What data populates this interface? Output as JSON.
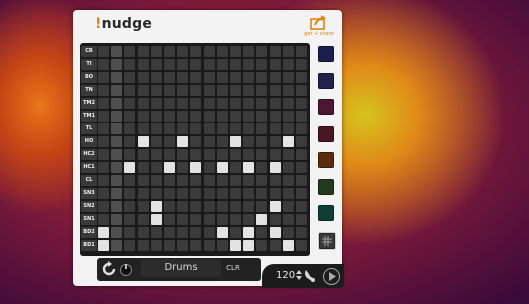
{
  "app": {
    "logo_mark": "!",
    "logo_text": "nudge",
    "share_label": "get + share"
  },
  "tracks": [
    "CR",
    "TI",
    "BO",
    "TN",
    "TM2",
    "TM1",
    "TL",
    "HO",
    "HC2",
    "HC1",
    "CL",
    "SN3",
    "SN2",
    "SN1",
    "BD2",
    "BD1"
  ],
  "steps": 16,
  "pattern": [
    [],
    [],
    [],
    [],
    [],
    [],
    [],
    [
      3,
      6,
      10,
      14
    ],
    [],
    [
      2,
      5,
      7,
      9,
      11,
      13
    ],
    [],
    [],
    [
      4,
      13
    ],
    [
      4,
      12
    ],
    [
      0,
      9,
      11,
      13
    ],
    [
      0,
      10,
      11,
      14
    ]
  ],
  "highlight_step": 1,
  "swatches": [
    {
      "name": "swatch-blue",
      "color": "#1a1f4d"
    },
    {
      "name": "swatch-indigo",
      "color": "#23204a"
    },
    {
      "name": "swatch-plum",
      "color": "#4a1734"
    },
    {
      "name": "swatch-maroon",
      "color": "#4a1524"
    },
    {
      "name": "swatch-brown",
      "color": "#5a2d0e"
    },
    {
      "name": "swatch-olive",
      "color": "#233a1e"
    },
    {
      "name": "swatch-teal",
      "color": "#103e36"
    }
  ],
  "toolbar": {
    "kit_name": "Drums",
    "clr_label": "CLR"
  },
  "transport": {
    "tempo": "120"
  },
  "colors": {
    "accent": "#e08412",
    "cell_on": "#e3e3e3",
    "cell_off": "#3b3b3b"
  }
}
